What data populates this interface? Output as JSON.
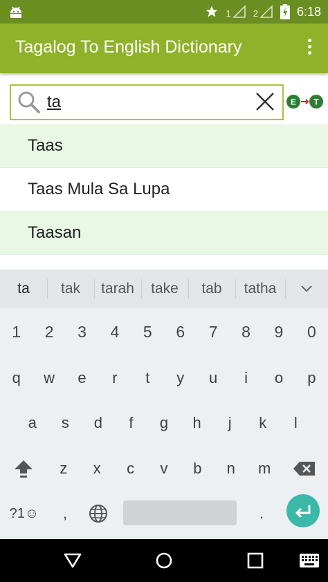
{
  "status": {
    "time": "6:18",
    "sim1": "1",
    "sim2": "2"
  },
  "appbar": {
    "title": "Tagalog To English Dictionary"
  },
  "search": {
    "value": "ta",
    "toggle_left": "E",
    "toggle_right": "T"
  },
  "results": [
    {
      "word": "Taas"
    },
    {
      "word": "Taas Mula Sa Lupa"
    },
    {
      "word": "Taasan"
    }
  ],
  "keyboard": {
    "suggestions": [
      "ta",
      "tak",
      "tarah",
      "take",
      "tab",
      "tatha"
    ],
    "numbers": [
      "1",
      "2",
      "3",
      "4",
      "5",
      "6",
      "7",
      "8",
      "9",
      "0"
    ],
    "row1": [
      "q",
      "w",
      "e",
      "r",
      "t",
      "y",
      "u",
      "i",
      "o",
      "p"
    ],
    "row2": [
      "a",
      "s",
      "d",
      "f",
      "g",
      "h",
      "j",
      "k",
      "l"
    ],
    "row3": [
      "z",
      "x",
      "c",
      "v",
      "b",
      "n",
      "m"
    ],
    "symbols_label": "?1☺",
    "comma": ",",
    "period": "."
  },
  "colors": {
    "status": "#6b8e23",
    "appbar": "#8fb22a",
    "row_alt": "#e8f8e4",
    "enter": "#3cb8a8"
  }
}
